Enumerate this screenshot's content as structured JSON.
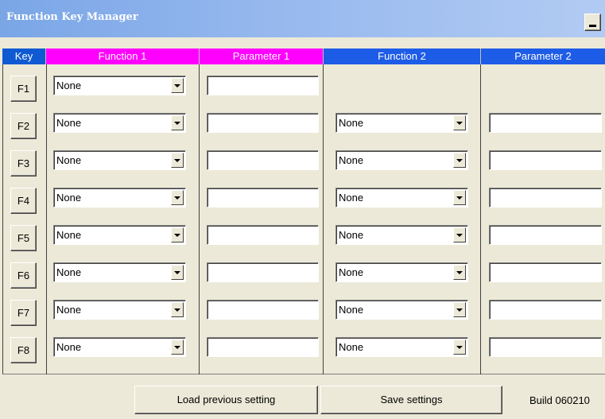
{
  "window": {
    "title": "Function Key Manager",
    "minimize_icon": "minimize-icon"
  },
  "columns": {
    "key": "Key",
    "function1": "Function 1",
    "parameter1": "Parameter 1",
    "function2": "Function 2",
    "parameter2": "Parameter 2"
  },
  "colors": {
    "function1_header": "#ff00ff",
    "parameter1_header": "#ff00ff",
    "function2_header": "#1d5ce6",
    "parameter2_header": "#1d5ce6",
    "key_header": "#0f5ad2"
  },
  "rows": [
    {
      "key": "F1",
      "function1": "None",
      "parameter1": "",
      "function2": null,
      "parameter2": null
    },
    {
      "key": "F2",
      "function1": "None",
      "parameter1": "",
      "function2": "None",
      "parameter2": ""
    },
    {
      "key": "F3",
      "function1": "None",
      "parameter1": "",
      "function2": "None",
      "parameter2": ""
    },
    {
      "key": "F4",
      "function1": "None",
      "parameter1": "",
      "function2": "None",
      "parameter2": ""
    },
    {
      "key": "F5",
      "function1": "None",
      "parameter1": "",
      "function2": "None",
      "parameter2": ""
    },
    {
      "key": "F6",
      "function1": "None",
      "parameter1": "",
      "function2": "None",
      "parameter2": ""
    },
    {
      "key": "F7",
      "function1": "None",
      "parameter1": "",
      "function2": "None",
      "parameter2": ""
    },
    {
      "key": "F8",
      "function1": "None",
      "parameter1": "",
      "function2": "None",
      "parameter2": ""
    }
  ],
  "footer": {
    "load_label": "Load previous setting",
    "save_label": "Save settings",
    "build": "Build 060210"
  }
}
